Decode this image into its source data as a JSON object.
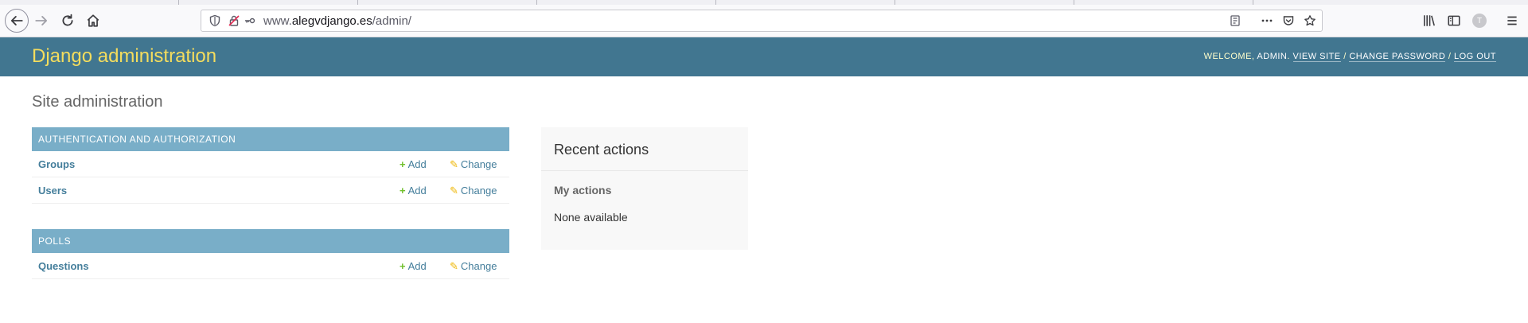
{
  "browser": {
    "url_prefix": "www.",
    "url_host": "alegvdjango.es",
    "url_path": "/admin/",
    "avatar_letter": "T"
  },
  "header": {
    "brand": "Django administration",
    "welcome": "Welcome,",
    "username": "admin",
    "view_site": "View site",
    "change_password": "Change password",
    "log_out": "Log out",
    "separator": "/"
  },
  "content": {
    "title": "Site administration",
    "apps": [
      {
        "caption": "Authentication and Authorization",
        "models": [
          {
            "name": "Groups",
            "add": "Add",
            "change": "Change"
          },
          {
            "name": "Users",
            "add": "Add",
            "change": "Change"
          }
        ]
      },
      {
        "caption": "Polls",
        "models": [
          {
            "name": "Questions",
            "add": "Add",
            "change": "Change"
          }
        ]
      }
    ]
  },
  "recent_actions": {
    "title": "Recent actions",
    "subtitle": "My actions",
    "empty": "None available"
  },
  "colors": {
    "header_bg": "#417690",
    "brand": "#f5dd5d",
    "module_caption_bg": "#79aec8",
    "link": "#447e9b",
    "add_icon": "#70bf2b",
    "change_icon": "#efb80b"
  }
}
